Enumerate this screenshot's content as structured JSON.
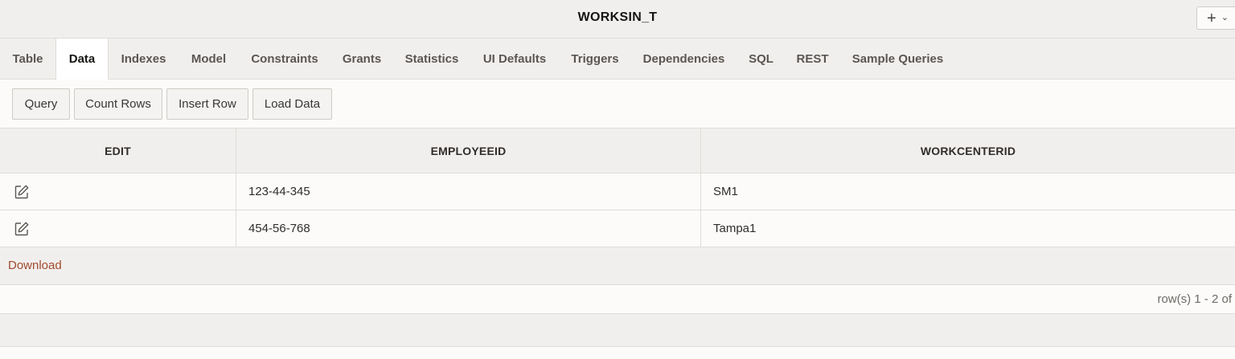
{
  "header": {
    "title": "WORKSIN_T",
    "add_menu": {
      "plus_glyph": "+",
      "chevron_glyph": "⌄"
    }
  },
  "tabs": [
    {
      "label": "Table",
      "active": false
    },
    {
      "label": "Data",
      "active": true
    },
    {
      "label": "Indexes",
      "active": false
    },
    {
      "label": "Model",
      "active": false
    },
    {
      "label": "Constraints",
      "active": false
    },
    {
      "label": "Grants",
      "active": false
    },
    {
      "label": "Statistics",
      "active": false
    },
    {
      "label": "UI Defaults",
      "active": false
    },
    {
      "label": "Triggers",
      "active": false
    },
    {
      "label": "Dependencies",
      "active": false
    },
    {
      "label": "SQL",
      "active": false
    },
    {
      "label": "REST",
      "active": false
    },
    {
      "label": "Sample Queries",
      "active": false
    }
  ],
  "toolbar": {
    "query_label": "Query",
    "count_rows_label": "Count Rows",
    "insert_row_label": "Insert Row",
    "load_data_label": "Load Data"
  },
  "grid": {
    "columns": [
      "EDIT",
      "EMPLOYEEID",
      "WORKCENTERID"
    ],
    "rows": [
      {
        "edit_icon": "edit-icon",
        "employeeid": "123-44-345",
        "workcenterid": "SM1"
      },
      {
        "edit_icon": "edit-icon",
        "employeeid": "454-56-768",
        "workcenterid": "Tampa1"
      }
    ]
  },
  "download": {
    "label": "Download"
  },
  "pagination": {
    "text": "row(s) 1 - 2 of"
  },
  "colors": {
    "accent_link": "#a04a2f",
    "panel_bg": "#f1efed",
    "content_bg": "#fcfbfa",
    "border": "#dfdcd8"
  }
}
